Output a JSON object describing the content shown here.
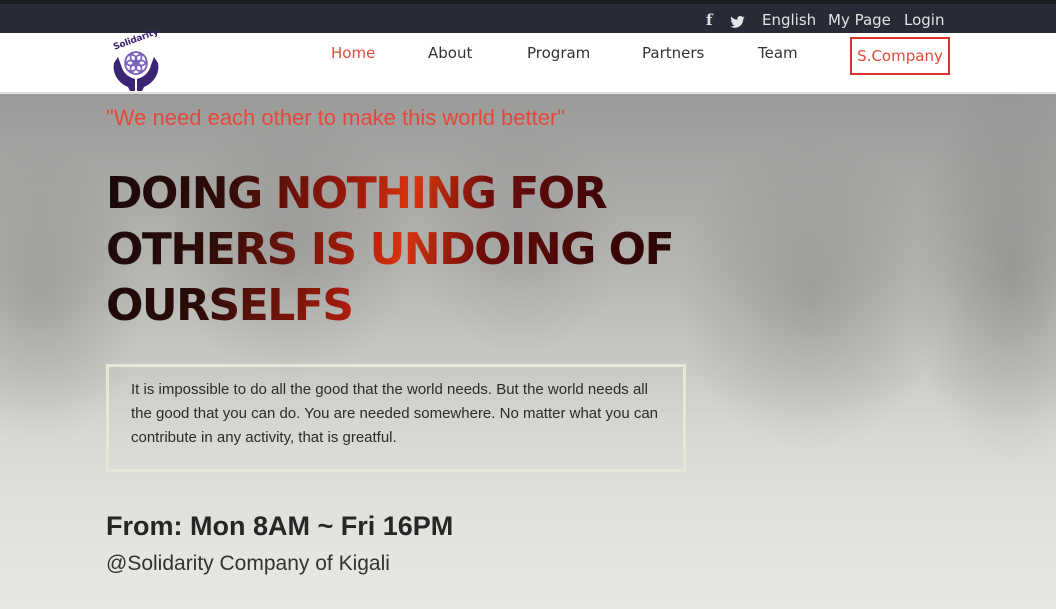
{
  "topbar": {
    "icons": [
      "facebook-icon",
      "twitter-icon"
    ],
    "language": "English",
    "my_page": "My Page",
    "login": "Login"
  },
  "logo": {
    "text": "Solidarity"
  },
  "nav": {
    "items": [
      {
        "label": "Home",
        "active": true
      },
      {
        "label": "About"
      },
      {
        "label": "Program"
      },
      {
        "label": "Partners"
      },
      {
        "label": "Team"
      },
      {
        "label": "S.Company",
        "highlighted": true
      }
    ]
  },
  "hero": {
    "quote": "\"We need each other to make this world better\"",
    "headline": "DOING NOTHING FOR OTHERS IS UNDOING OF OURSELFS",
    "message": "It is impossible to do all the good that the world needs. But the world needs all the good that you can do. You are needed somewhere. No matter what you can contribute in any activity, that is greatful.",
    "hours": "From: Mon 8AM ~ Fri 16PM",
    "place": "@Solidarity Company of Kigali"
  },
  "colors": {
    "accent": "#e2493a",
    "topbar_bg": "#282b35",
    "logo_purple": "#3d2472"
  }
}
